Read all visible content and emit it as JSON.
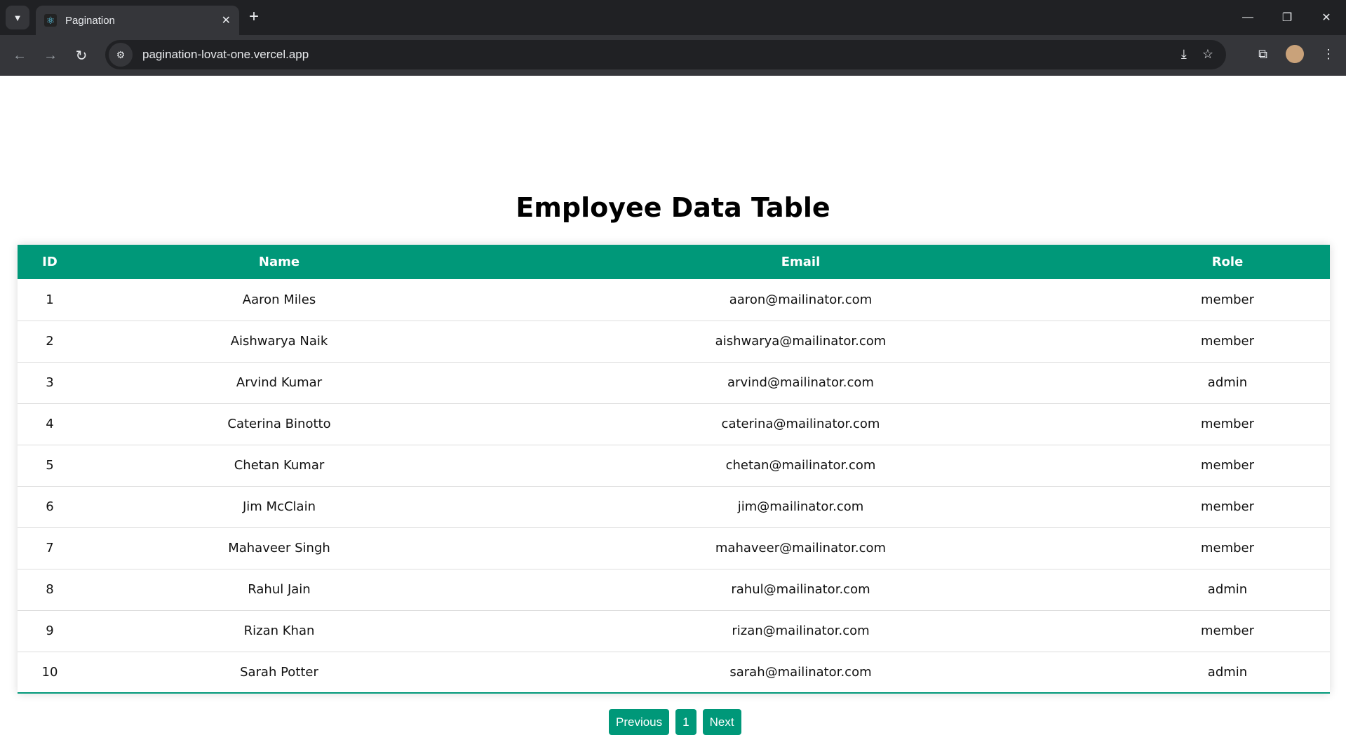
{
  "browser": {
    "tab_title": "Pagination",
    "url": "pagination-lovat-one.vercel.app"
  },
  "page": {
    "title": "Employee Data Table"
  },
  "table": {
    "headers": [
      "ID",
      "Name",
      "Email",
      "Role"
    ],
    "rows": [
      [
        "1",
        "Aaron Miles",
        "aaron@mailinator.com",
        "member"
      ],
      [
        "2",
        "Aishwarya Naik",
        "aishwarya@mailinator.com",
        "member"
      ],
      [
        "3",
        "Arvind Kumar",
        "arvind@mailinator.com",
        "admin"
      ],
      [
        "4",
        "Caterina Binotto",
        "caterina@mailinator.com",
        "member"
      ],
      [
        "5",
        "Chetan Kumar",
        "chetan@mailinator.com",
        "member"
      ],
      [
        "6",
        "Jim McClain",
        "jim@mailinator.com",
        "member"
      ],
      [
        "7",
        "Mahaveer Singh",
        "mahaveer@mailinator.com",
        "member"
      ],
      [
        "8",
        "Rahul Jain",
        "rahul@mailinator.com",
        "admin"
      ],
      [
        "9",
        "Rizan Khan",
        "rizan@mailinator.com",
        "member"
      ],
      [
        "10",
        "Sarah Potter",
        "sarah@mailinator.com",
        "admin"
      ]
    ]
  },
  "pagination": {
    "previous": "Previous",
    "current": "1",
    "next": "Next"
  },
  "colors": {
    "accent": "#009879"
  }
}
